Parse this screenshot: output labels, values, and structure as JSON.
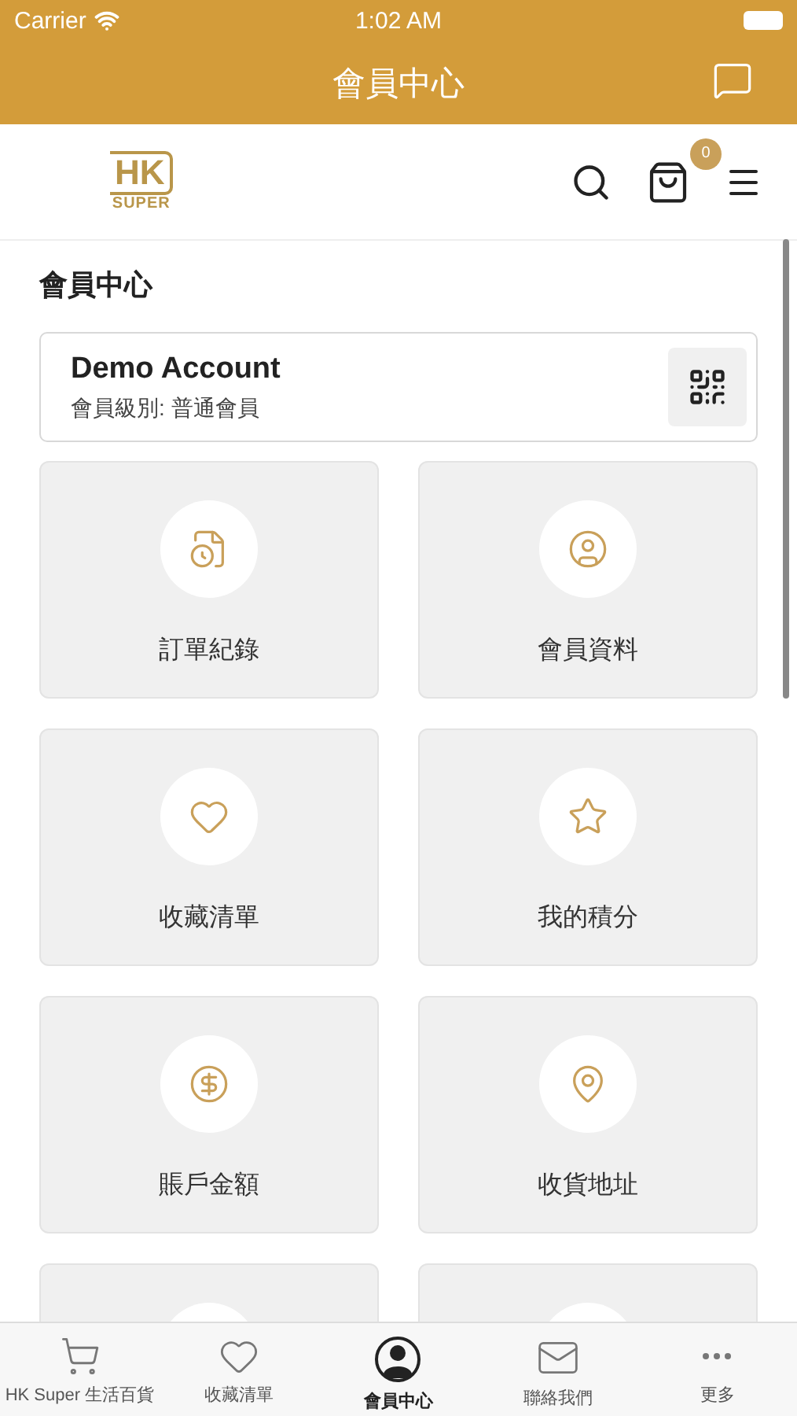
{
  "status_bar": {
    "carrier": "Carrier",
    "time": "1:02 AM"
  },
  "nav_bar": {
    "title": "會員中心"
  },
  "header": {
    "logo_mark": "HK",
    "logo_word": "SUPER",
    "cart_count": "0"
  },
  "section_title": "會員中心",
  "account": {
    "name": "Demo Account",
    "level": "會員級別: 普通會員"
  },
  "tiles": [
    {
      "kind": "order",
      "label": "訂單紀錄"
    },
    {
      "kind": "profile",
      "label": "會員資料"
    },
    {
      "kind": "heart",
      "label": "收藏清單"
    },
    {
      "kind": "star",
      "label": "我的積分"
    },
    {
      "kind": "dollar",
      "label": "賬戶金額"
    },
    {
      "kind": "pin",
      "label": "收貨地址"
    },
    {
      "kind": "partial"
    },
    {
      "kind": "partial"
    }
  ],
  "tab_bar": [
    {
      "kind": "cart",
      "label": "HK Super 生活百貨",
      "selected": false
    },
    {
      "kind": "heart",
      "label": "收藏清單",
      "selected": false
    },
    {
      "kind": "member",
      "label": "會員中心",
      "selected": true
    },
    {
      "kind": "mail",
      "label": "聯絡我們",
      "selected": false
    },
    {
      "kind": "more",
      "label": "更多",
      "selected": false
    }
  ]
}
